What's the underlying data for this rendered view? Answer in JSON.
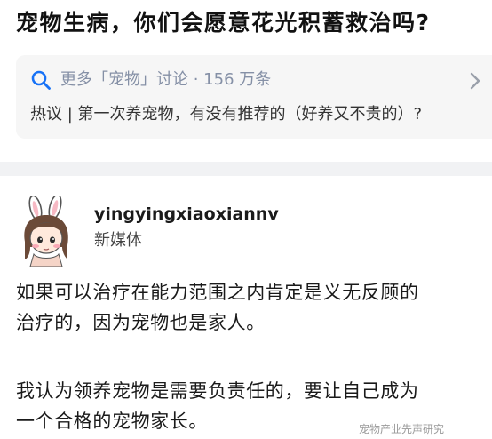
{
  "question": {
    "title": "宠物生病，你们会愿意花光积蓄救治吗?"
  },
  "related": {
    "search_text": "更多「宠物」讨论 · 156 万条",
    "hot_topic": "热议 | 第一次养宠物，有没有推荐的（好养又不贵的）?",
    "search_icon": "search-icon",
    "chevron_icon": "chevron-right-icon"
  },
  "answer": {
    "author": {
      "name": "yingyingxiaoxiannv",
      "tag": "新媒体",
      "avatar_icon": "bunny-girl-avatar"
    },
    "paragraphs": [
      {
        "lines": [
          "如果可以治疗在能力范围之内肯定是义无反顾的",
          "治疗的，因为宠物也是家人。"
        ]
      },
      {
        "lines": [
          "我认为领养宠物是需要负责任的，要让自己成为",
          "一个合格的宠物家长。"
        ]
      }
    ]
  },
  "watermark": {
    "text": "宠物产业先声研究"
  },
  "colors": {
    "search_icon": "#1772f6",
    "muted_text": "#8590a6",
    "card_bg": "#f6f6f6",
    "divider": "#f1f2f4"
  }
}
